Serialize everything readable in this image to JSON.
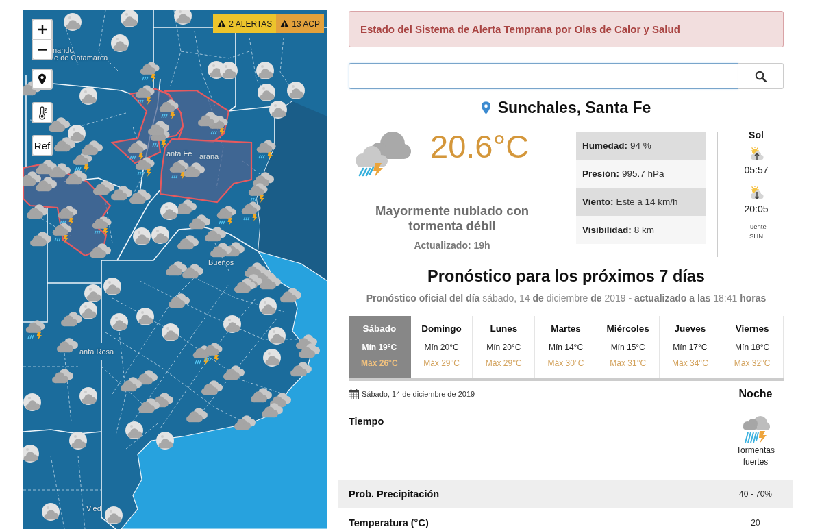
{
  "map": {
    "badges": [
      {
        "label": "2 ALERTAS",
        "color": "#ecc42c"
      },
      {
        "label": "13 ACP",
        "color": "#e3a13b"
      }
    ],
    "ref_button": "Ref",
    "labels": [
      "nando",
      "e de Catamarca",
      "anta Fe",
      "arana",
      "Buenos",
      "anta Rosa",
      "Vied"
    ]
  },
  "alert_banner": {
    "text": "Estado del Sistema de Alerta Temprana por Olas de Calor y Salud"
  },
  "search": {
    "focused": true
  },
  "location": {
    "name": "Sunchales, Santa Fe"
  },
  "current": {
    "temperature": "20.6°C",
    "description": "Mayormente nublado con tormenta débil",
    "updated": "Actualizado: 19h",
    "stats": [
      {
        "label": "Humedad:",
        "value": "94 %"
      },
      {
        "label": "Presión:",
        "value": "995.7 hPa"
      },
      {
        "label": "Viento:",
        "value": "Este a 14 km/h"
      },
      {
        "label": "Visibilidad:",
        "value": "8 km"
      }
    ],
    "sun": {
      "title": "Sol",
      "sunrise": "05:57",
      "sunset": "20:05",
      "source": "Fuente SHN"
    }
  },
  "forecast": {
    "title": "Pronóstico para los próximos 7 días",
    "subtitle": "**Pronóstico oficial del día** sábado, 14 **de** diciembre **de** 2019 **- actualizado a las** 18:41 **horas**",
    "days": [
      {
        "name": "Sábado",
        "min": "Mín 19°C",
        "max": "Máx 26°C",
        "selected": true
      },
      {
        "name": "Domingo",
        "min": "Mín 20°C",
        "max": "Máx 29°C",
        "selected": false
      },
      {
        "name": "Lunes",
        "min": "Mín 20°C",
        "max": "Máx 29°C",
        "selected": false
      },
      {
        "name": "Martes",
        "min": "Mín 14°C",
        "max": "Máx 30°C",
        "selected": false
      },
      {
        "name": "Miércoles",
        "min": "Mín 15°C",
        "max": "Máx 31°C",
        "selected": false
      },
      {
        "name": "Jueves",
        "min": "Mín 17°C",
        "max": "Máx 34°C",
        "selected": false
      },
      {
        "name": "Viernes",
        "min": "Mín 18°C",
        "max": "Máx 32°C",
        "selected": false
      }
    ]
  },
  "detail": {
    "date": "Sábado, 14 de diciembre de 2019",
    "period": "Noche",
    "rows": [
      {
        "kind": "weather",
        "label": "Tiempo",
        "value": "Tormentas fuertes"
      },
      {
        "kind": "value",
        "label": "Prob. Precipitación",
        "value": "40 - 70%"
      },
      {
        "kind": "value",
        "label": "Temperatura (°C)",
        "value": "20"
      }
    ]
  }
}
